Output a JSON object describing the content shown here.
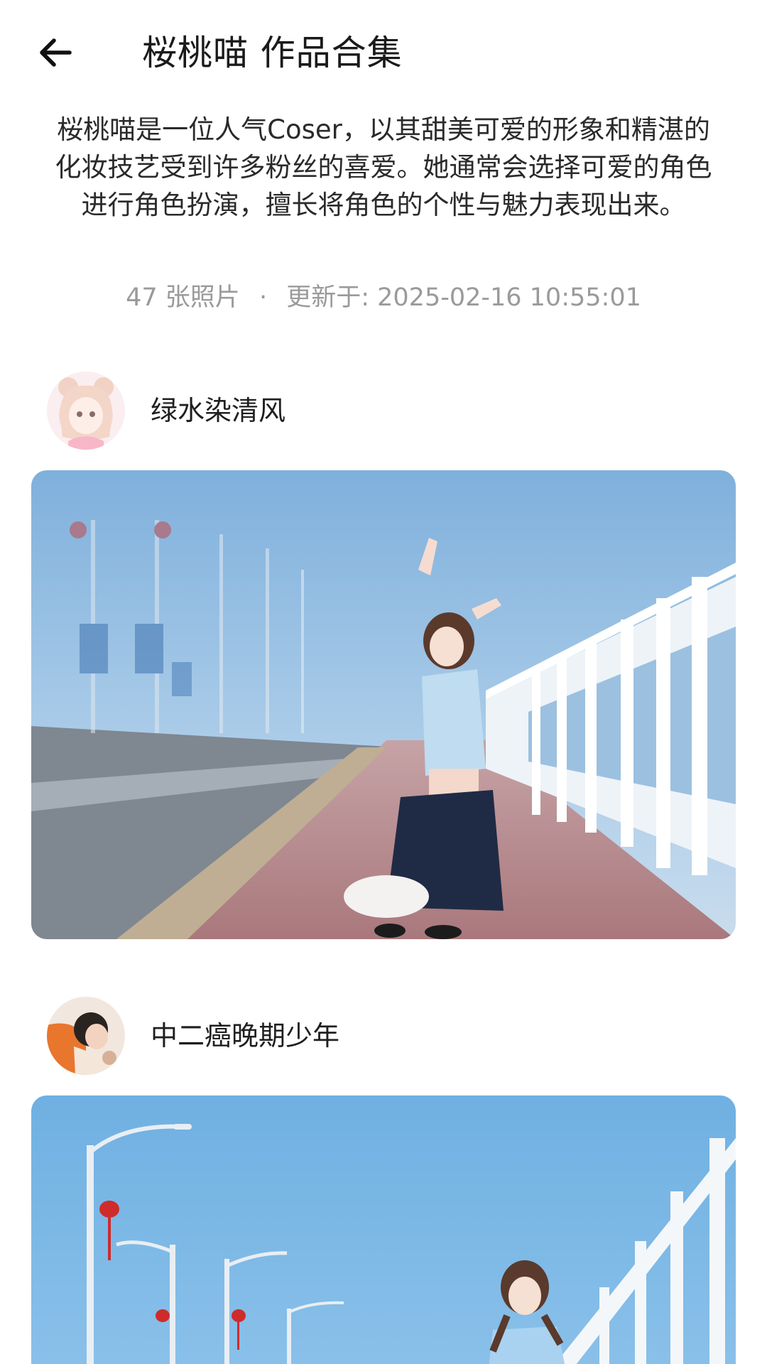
{
  "header": {
    "back_icon": "arrow-left-icon",
    "title": "桜桃喵 作品合集"
  },
  "collection": {
    "description": "桜桃喵是一位人气Coser，以其甜美可爱的形象和精湛的化妆技艺受到许多粉丝的喜爱。她通常会选择可爱的角色进行角色扮演，擅长将角色的个性与魅力表现出来。",
    "photo_count": "47 张照片",
    "separator": "·",
    "updated": "更新于: 2025-02-16 10:55:01"
  },
  "posts": [
    {
      "author": "绿水染清风"
    },
    {
      "author": "中二癌晚期少年"
    }
  ],
  "colors": {
    "text_primary": "#1a1a1a",
    "text_secondary": "#9a9a9a",
    "sky": "#8fb9de"
  }
}
